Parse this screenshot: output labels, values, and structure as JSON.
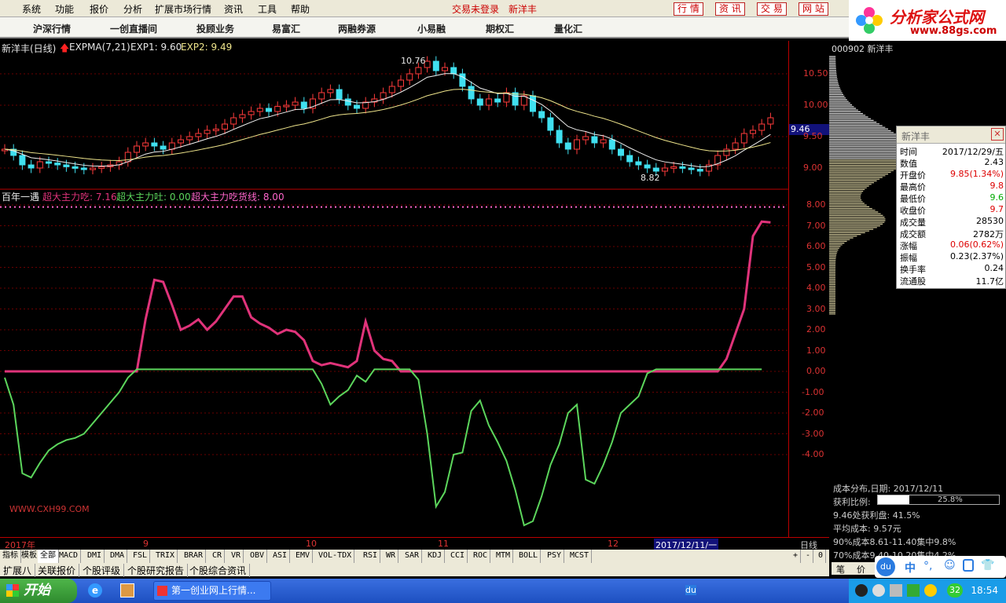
{
  "menu": {
    "items": [
      "系统",
      "功能",
      "报价",
      "分析",
      "扩展市场行情",
      "资讯",
      "工具",
      "帮助"
    ],
    "status": "交易未登录",
    "stock_name": "新洋丰",
    "right_buttons": [
      "行 情",
      "资 讯",
      "交 易",
      "网 站"
    ]
  },
  "nav": {
    "items": [
      "沪深行情",
      "一创直播间",
      "投顾业务",
      "易富汇",
      "两融券源",
      "小易融",
      "期权汇",
      "量化汇"
    ]
  },
  "logo": {
    "title": "分析家公式网",
    "url": "www.88gs.com"
  },
  "price_chart": {
    "title": "新洋丰(日线)",
    "indicator": "EXPMA(7,21)",
    "exp1": "EXP1: 9.60",
    "exp2": "EXP2: 9.49",
    "high_label": "10.76",
    "low_label": "8.82",
    "last_price_tag": "9.46",
    "y_ticks": [
      "10.50",
      "10.00",
      "9.50",
      "9.00"
    ]
  },
  "indicator_chart": {
    "title": "百年一遇",
    "s1": "超大主力吃: 7.16",
    "s2": "超大主力吐: 0.00",
    "s3": "超大主力吃货线: 8.00",
    "watermark": "WWW.CXH99.COM",
    "y_ticks": [
      "8.00",
      "7.00",
      "6.00",
      "5.00",
      "4.00",
      "3.00",
      "2.00",
      "1.00",
      "0.00",
      "-1.00",
      "-2.00",
      "-3.00",
      "-4.00"
    ],
    "colors": {
      "s1": "#e0337a",
      "s2": "#5cd65c",
      "s3": "#ff66cc"
    }
  },
  "bottom_axis": {
    "labels": [
      "2017年",
      "9",
      "10",
      "11",
      "12"
    ],
    "cursor_date": "2017/12/11/一",
    "period": "日线"
  },
  "indicator_tabs": [
    "指标",
    "模板",
    "全部",
    "MACD",
    "DMI",
    "DMA",
    "FSL",
    "TRIX",
    "BRAR",
    "CR",
    "VR",
    "OBV",
    "ASI",
    "EMV",
    "VOL-TDX",
    "RSI",
    "WR",
    "SAR",
    "KDJ",
    "CCI",
    "ROC",
    "MTM",
    "BOLL",
    "PSY",
    "MCST"
  ],
  "tab_controls": [
    "+",
    "-",
    "0"
  ],
  "sub_tabs": [
    "扩展八",
    "关联报价",
    "个股评级",
    "个股研究报告",
    "个股综合资讯"
  ],
  "right_panel": {
    "code": "000902 新洋丰",
    "info_title": "新洋丰",
    "info_rows": [
      {
        "label": "时间",
        "value": "2017/12/29/五"
      },
      {
        "label": "数值",
        "value": "2.43"
      },
      {
        "label": "开盘价",
        "value": "9.85(1.34%)"
      },
      {
        "label": "最高价",
        "value": "9.8"
      },
      {
        "label": "最低价",
        "value": "9.6"
      },
      {
        "label": "收盘价",
        "value": "9.7"
      },
      {
        "label": "成交量",
        "value": "28530"
      },
      {
        "label": "成交额",
        "value": "2782万"
      },
      {
        "label": "涨幅",
        "value": "0.06(0.62%)"
      },
      {
        "label": "振幅",
        "value": "0.23(2.37%)"
      },
      {
        "label": "换手率",
        "value": "0.24"
      },
      {
        "label": "流通股",
        "value": "11.7亿"
      }
    ],
    "cost": {
      "date": "成本分布,日期: 2017/12/11",
      "profit_label": "获利比例:",
      "profit_pct": "25.8%",
      "profit_fraction": 0.258,
      "profit_at": "9.46处获利盘: 41.5%",
      "avg_cost": "平均成本: 9.57元",
      "c90": "90%成本8.61-11.40集中9.8%",
      "c70": "70%成本9.40-10.20集中4.2%"
    },
    "bottom_tabs": [
      "笔",
      "价"
    ]
  },
  "taskbar": {
    "start": "开始",
    "app": "第一创业网上行情...",
    "clock": "18:54",
    "badge": "32"
  }
}
